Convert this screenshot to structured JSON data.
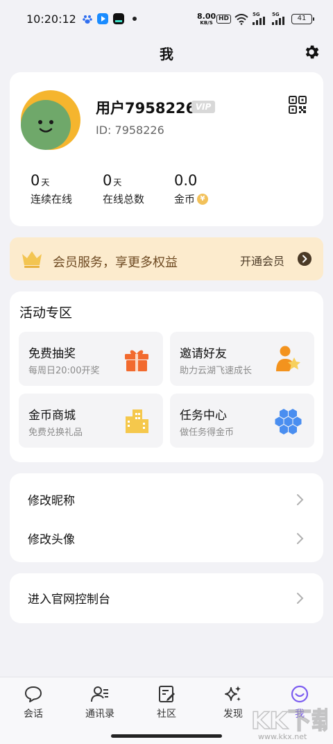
{
  "status_bar": {
    "time": "10:20:12",
    "network_speed_value": "8.00",
    "network_speed_unit": "KB/S",
    "hd_label": "HD",
    "signal_label_1": "5G",
    "signal_label_2": "5G",
    "battery": "41"
  },
  "header": {
    "title": "我",
    "settings_icon": "gear-icon"
  },
  "profile": {
    "username": "用户7958226",
    "vip_label": "VIP",
    "id_text": "ID: 7958226",
    "stats": [
      {
        "value": "0",
        "unit": "天",
        "label": "连续在线"
      },
      {
        "value": "0",
        "unit": "天",
        "label": "在线总数"
      },
      {
        "value": "0.0",
        "unit": "",
        "label": "金币"
      }
    ],
    "coin_symbol": "¥"
  },
  "member_banner": {
    "text": "会员服务，享更多权益",
    "action": "开通会员"
  },
  "activity": {
    "title": "活动专区",
    "tiles": [
      {
        "title": "免费抽奖",
        "subtitle": "每周日20:00开奖",
        "icon": "gift-icon"
      },
      {
        "title": "邀请好友",
        "subtitle": "助力云湖飞速成长",
        "icon": "invite-user-icon"
      },
      {
        "title": "金币商城",
        "subtitle": "免费兑换礼品",
        "icon": "building-icon"
      },
      {
        "title": "任务中心",
        "subtitle": "做任务得金币",
        "icon": "hexagon-cluster-icon"
      }
    ]
  },
  "menu": {
    "items": [
      {
        "label": "修改昵称"
      },
      {
        "label": "修改头像"
      }
    ],
    "console": {
      "label": "进入官网控制台"
    }
  },
  "bottom_nav": {
    "items": [
      {
        "label": "会话",
        "icon": "chat-bubble-icon"
      },
      {
        "label": "通讯录",
        "icon": "contacts-icon"
      },
      {
        "label": "社区",
        "icon": "edit-note-icon"
      },
      {
        "label": "发现",
        "icon": "sparkle-icon"
      },
      {
        "label": "我",
        "icon": "smile-icon"
      }
    ],
    "active_index": 4
  },
  "watermark": {
    "text": "KK下载",
    "url": "www.kkx.net"
  },
  "colors": {
    "accent": "#7b5cf0",
    "banner_bg": "#fcebcd",
    "banner_text": "#6e4a22",
    "gift": "#f26a2e",
    "gold": "#f5b52e",
    "blue": "#4a8ef0"
  }
}
